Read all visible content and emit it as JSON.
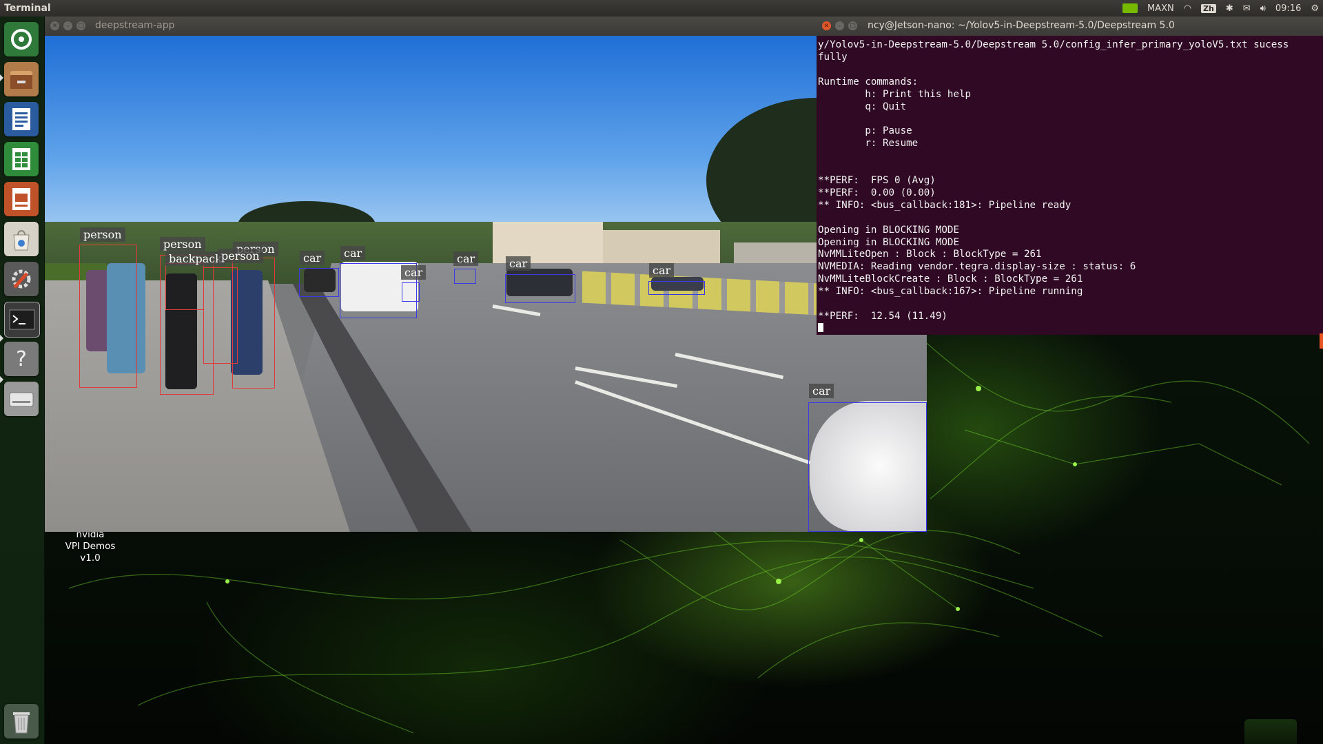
{
  "top_panel": {
    "app_name": "Terminal",
    "tray": {
      "power_mode": "MAXN",
      "input_method": "Zh",
      "time": "09:16"
    }
  },
  "launcher": {
    "items": [
      {
        "name": "ubuntu-home-icon"
      },
      {
        "name": "file-manager-icon"
      },
      {
        "name": "writer-icon"
      },
      {
        "name": "calc-icon"
      },
      {
        "name": "impress-icon"
      },
      {
        "name": "software-center-icon"
      },
      {
        "name": "system-settings-icon"
      },
      {
        "name": "terminal-icon"
      },
      {
        "name": "help-icon"
      },
      {
        "name": "drive-icon"
      },
      {
        "name": "trash-icon"
      }
    ]
  },
  "deepstream_window": {
    "title": "deepstream-app",
    "detections": [
      {
        "label": "person"
      },
      {
        "label": "person"
      },
      {
        "label": "backpack"
      },
      {
        "label": "person"
      },
      {
        "label": "person"
      },
      {
        "label": "car"
      },
      {
        "label": "car"
      },
      {
        "label": "car"
      },
      {
        "label": "car"
      },
      {
        "label": "car"
      },
      {
        "label": "car"
      },
      {
        "label": "car"
      }
    ]
  },
  "terminal": {
    "title": "ncy@Jetson-nano: ~/Yolov5-in-Deepstream-5.0/Deepstream 5.0",
    "lines": [
      "y/Yolov5-in-Deepstream-5.0/Deepstream 5.0/config_infer_primary_yoloV5.txt sucess",
      "fully",
      "",
      "Runtime commands:",
      "        h: Print this help",
      "        q: Quit",
      "",
      "        p: Pause",
      "        r: Resume",
      "",
      "",
      "**PERF:  FPS 0 (Avg)",
      "**PERF:  0.00 (0.00)",
      "** INFO: <bus_callback:181>: Pipeline ready",
      "",
      "Opening in BLOCKING MODE",
      "Opening in BLOCKING MODE",
      "NvMMLiteOpen : Block : BlockType = 261",
      "NVMEDIA: Reading vendor.tegra.display-size : status: 6",
      "NvMMLiteBlockCreate : Block : BlockType = 261",
      "** INFO: <bus_callback:167>: Pipeline running",
      "",
      "**PERF:  12.54 (11.49)"
    ]
  },
  "desktop_icon": {
    "line1": "nvidia",
    "line2": "VPI Demos",
    "line3": "v1.0"
  }
}
